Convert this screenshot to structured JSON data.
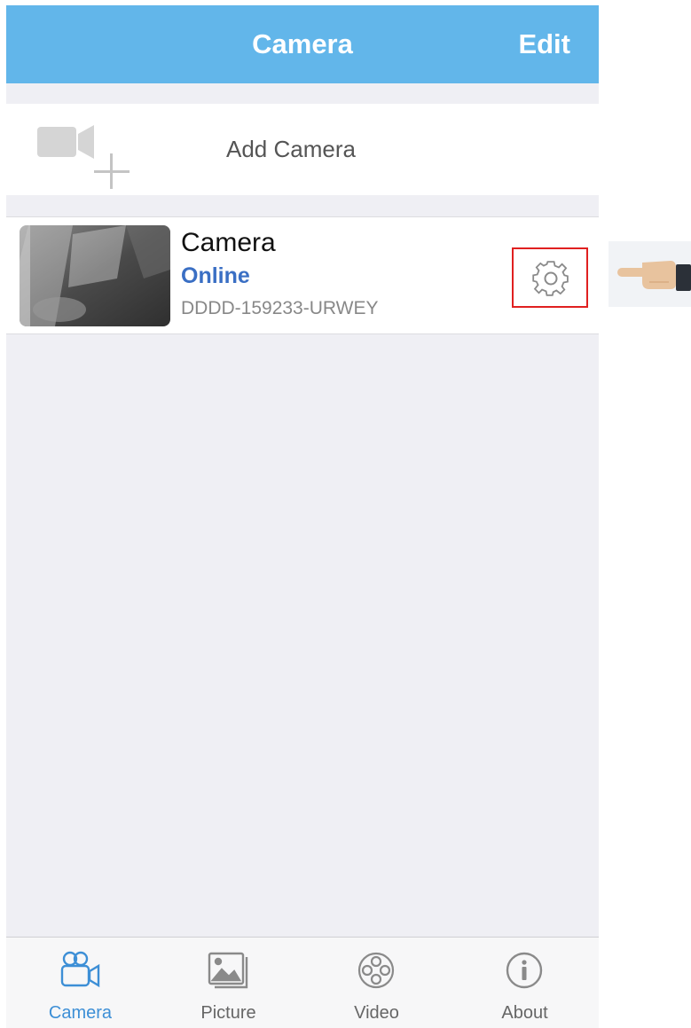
{
  "nav": {
    "title": "Camera",
    "edit_label": "Edit"
  },
  "add_camera": {
    "label": "Add Camera",
    "icon": "video-camera-add-icon"
  },
  "cameras": [
    {
      "name": "Camera",
      "status": "Online",
      "id": "DDDD-159233-URWEY",
      "status_color": "#3a6fc4"
    }
  ],
  "tabs": [
    {
      "label": "Camera",
      "icon": "camera-tab-icon",
      "active": true
    },
    {
      "label": "Picture",
      "icon": "picture-tab-icon",
      "active": false
    },
    {
      "label": "Video",
      "icon": "video-tab-icon",
      "active": false
    },
    {
      "label": "About",
      "icon": "about-tab-icon",
      "active": false
    }
  ],
  "colors": {
    "nav_bar": "#62b6ea",
    "active_tab": "#3d8fd6",
    "highlight_box": "#e02020",
    "background": "#efeff4"
  }
}
